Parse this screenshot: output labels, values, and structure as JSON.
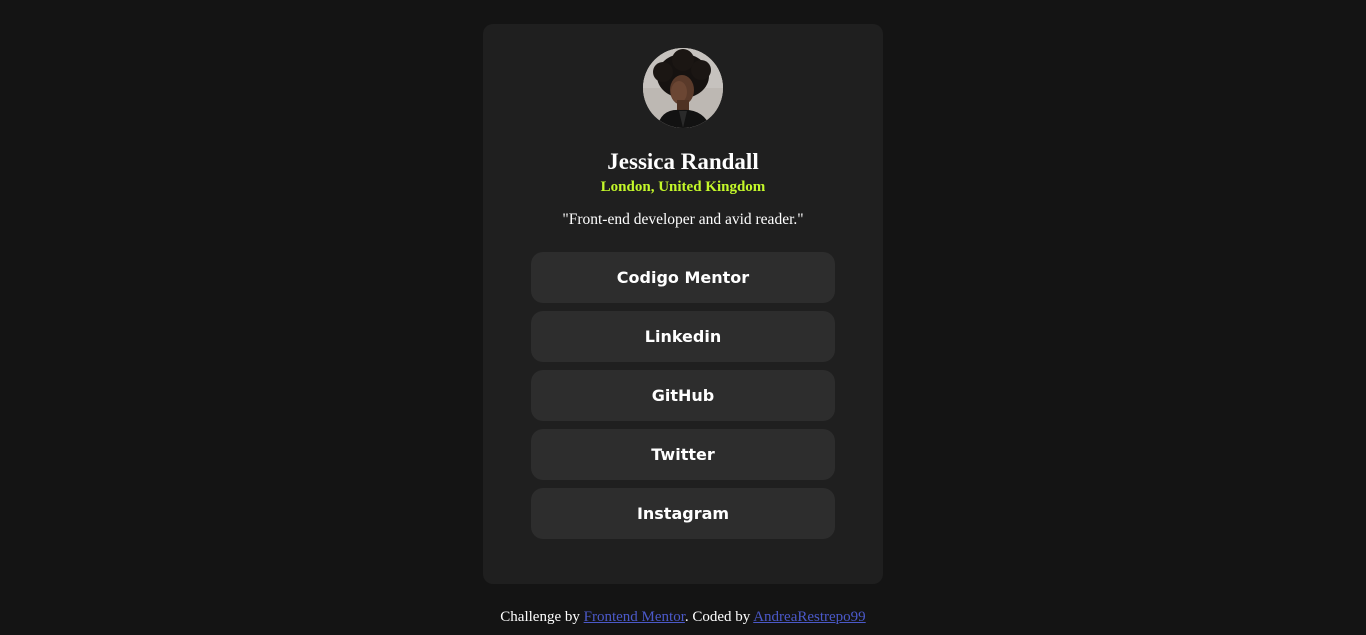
{
  "profile": {
    "name": "Jessica Randall",
    "location": "London, United Kingdom",
    "bio": "\"Front-end developer and avid reader.\""
  },
  "links": [
    {
      "label": "Codigo Mentor"
    },
    {
      "label": "Linkedin"
    },
    {
      "label": "GitHub"
    },
    {
      "label": "Twitter"
    },
    {
      "label": "Instagram"
    }
  ],
  "footer": {
    "prefix": "Challenge by ",
    "challenge_link": "Frontend Mentor",
    "middle": ". Coded by ",
    "author_link": "AndreaRestrepo99"
  },
  "colors": {
    "background": "#141414",
    "card": "#1f1f1f",
    "button": "#2d2d2d",
    "accent": "#c4f82a",
    "link": "#4b59c9"
  }
}
